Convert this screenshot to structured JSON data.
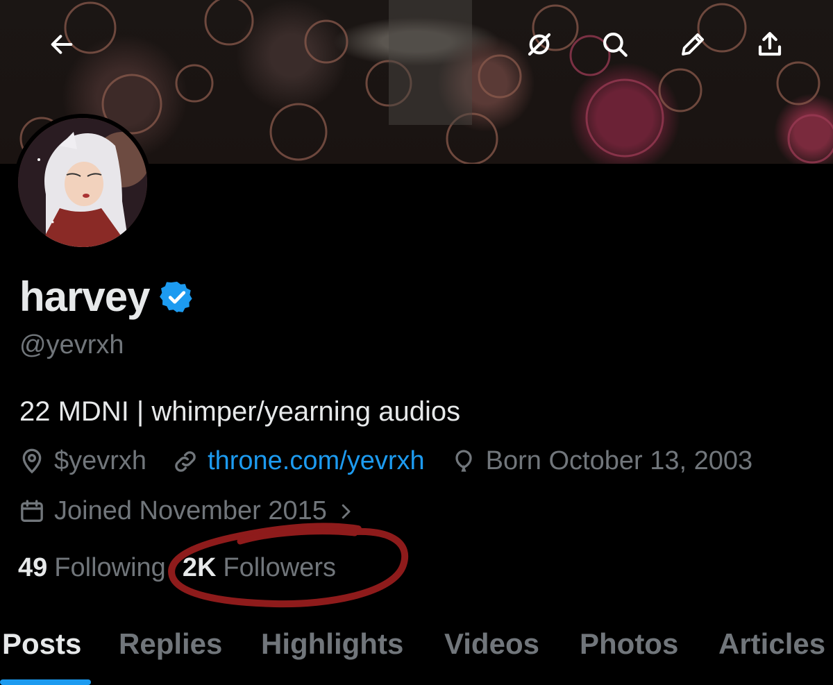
{
  "header": {
    "back_icon": "arrow-left-icon",
    "actions": [
      "grok-icon",
      "search-icon",
      "edit-icon",
      "share-icon"
    ]
  },
  "profile": {
    "name": "harvey",
    "verified": true,
    "handle": "@yevrxh",
    "bio": "22 MDNI | whimper/yearning audios",
    "location": "$yevrxh",
    "website": "throne.com/yevrxh",
    "birthday": "Born October 13, 2003",
    "joined": "Joined November 2015",
    "following_count": "49",
    "following_label": "Following",
    "followers_count": "2K",
    "followers_label": "Followers"
  },
  "tabs": [
    {
      "label": "Posts",
      "active": true
    },
    {
      "label": "Replies",
      "active": false
    },
    {
      "label": "Highlights",
      "active": false
    },
    {
      "label": "Videos",
      "active": false
    },
    {
      "label": "Photos",
      "active": false
    },
    {
      "label": "Articles",
      "active": false
    }
  ],
  "colors": {
    "accent": "#1d9bf0",
    "annotation": "#8e1b1b",
    "muted": "#71767b"
  }
}
